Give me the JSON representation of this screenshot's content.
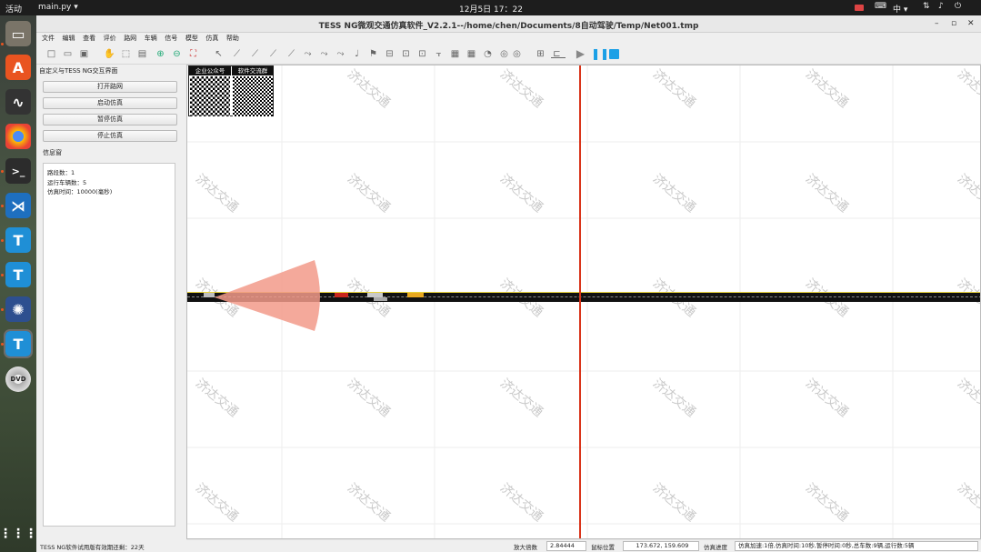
{
  "topbar": {
    "activities": "活动",
    "app": "main.py ▾",
    "clock": "12月5日  17：22",
    "lang": "中 ▾"
  },
  "window": {
    "title": "TESS NG微观交通仿真软件_V2.2.1--/home/chen/Documents/8自动驾驶/Temp/Net001.tmp",
    "min": "–",
    "max": "▫",
    "close": "✕"
  },
  "menu": [
    "文件",
    "编辑",
    "查看",
    "评价",
    "路网",
    "车辆",
    "信号",
    "模型",
    "仿真",
    "帮助"
  ],
  "left": {
    "header": "自定义与TESS NG交互界面",
    "buttons": [
      "打开路网",
      "启动仿真",
      "暂停仿真",
      "停止仿真"
    ],
    "info_label": "信息窗",
    "info_lines": [
      "路段数：1",
      "运行车辆数：5",
      "仿真时间：10000(毫秒)"
    ]
  },
  "qr": {
    "left_title": "企业公众号",
    "right_title": "软件交流群"
  },
  "watermark": "济达交通",
  "status": {
    "trial": "TESS NG软件试用版有效期还剩：22天",
    "zoom_label": "放大倍数",
    "zoom_value": "2.84444",
    "pos_label": "鼠标位置",
    "pos_value": "173.672, 159.609",
    "progress_label": "仿真进度",
    "progress_value": "仿真加速:1倍,仿真时间:10秒,暂停时间:0秒,总车数:9辆,运行数:5辆"
  },
  "colors": {
    "road": "#111111",
    "lane_line": "#e8d23a",
    "sensor_fan": "#f29a8a",
    "marker": "#d9341a"
  }
}
